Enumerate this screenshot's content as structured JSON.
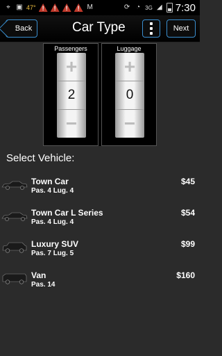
{
  "status_bar": {
    "temperature": "47°",
    "network": "3G",
    "time": "7:30",
    "icons": [
      "location-icon",
      "image-icon",
      "weather-icon",
      "warning-icon",
      "warning-icon",
      "warning-icon",
      "warning-icon",
      "gmail-icon",
      "sync-icon",
      "wifi-icon",
      "signal-icon",
      "battery-icon"
    ]
  },
  "header": {
    "back_label": "Back",
    "title": "Car Type",
    "next_label": "Next"
  },
  "counters": {
    "passengers": {
      "label": "Passengers",
      "value": "2",
      "plus": "+",
      "minus": "−"
    },
    "luggage": {
      "label": "Luggage",
      "value": "0",
      "plus": "+",
      "minus": "−"
    }
  },
  "select_label": "Select Vehicle:",
  "vehicles": [
    {
      "name": "Town Car",
      "details": "Pas. 4 Lug. 4",
      "price": "$45",
      "icon": "sedan-icon"
    },
    {
      "name": "Town Car L Series",
      "details": "Pas. 4 Lug. 4",
      "price": "$54",
      "icon": "sedan-icon"
    },
    {
      "name": "Luxury SUV",
      "details": "Pas. 7 Lug. 5",
      "price": "$99",
      "icon": "suv-icon"
    },
    {
      "name": "Van",
      "details": "Pas. 14",
      "price": "$160",
      "icon": "van-icon"
    }
  ],
  "colors": {
    "accent": "#3a8fd0",
    "background": "#2b2b2b",
    "warning": "#c0392b"
  }
}
